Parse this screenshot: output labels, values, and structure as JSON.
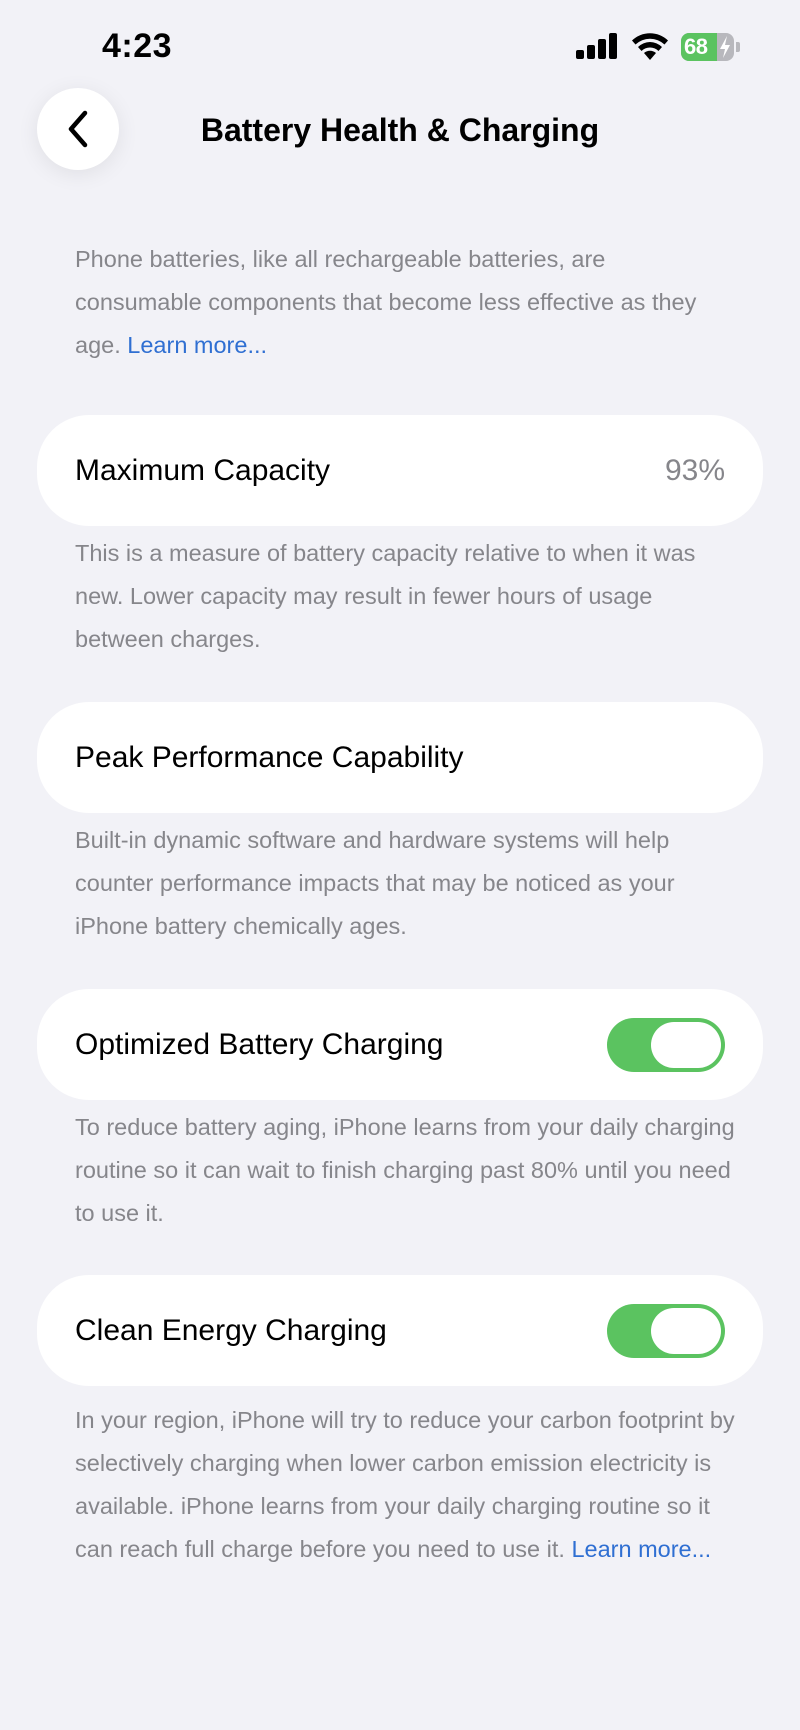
{
  "status_bar": {
    "time": "4:23",
    "battery_percent": "68",
    "battery_level": 68,
    "battery_color": "#5bc360"
  },
  "nav": {
    "back_icon": "chevron-left-icon",
    "title": "Battery Health & Charging"
  },
  "intro": {
    "text": "Phone batteries, like all rechargeable batteries, are consumable components that become less effective as they age.",
    "link": "Learn more..."
  },
  "maximum_capacity": {
    "label": "Maximum Capacity",
    "value": "93%",
    "footnote": "This is a measure of battery capacity relative to when it was new. Lower capacity may result in fewer hours of usage between charges."
  },
  "peak_performance": {
    "label": "Peak Performance Capability",
    "footnote": "Built-in dynamic software and hardware systems will help counter performance impacts that may be noticed as your iPhone battery chemically ages."
  },
  "optimized_charging": {
    "label": "Optimized Battery Charging",
    "enabled": true,
    "footnote": "To reduce battery aging, iPhone learns from your daily charging routine so it can wait to finish charging past 80% until you need to use it."
  },
  "clean_energy": {
    "label": "Clean Energy Charging",
    "enabled": true,
    "footnote": "In your region, iPhone will try to reduce your carbon footprint by selectively charging when lower carbon emission electricity is available. iPhone learns from your daily charging routine so it can reach full charge before you need to use it.",
    "link": "Learn more..."
  },
  "colors": {
    "background": "#f2f2f7",
    "card": "#ffffff",
    "secondary_text": "#86868b",
    "link": "#2f6fd2",
    "toggle_on": "#5bc360"
  }
}
